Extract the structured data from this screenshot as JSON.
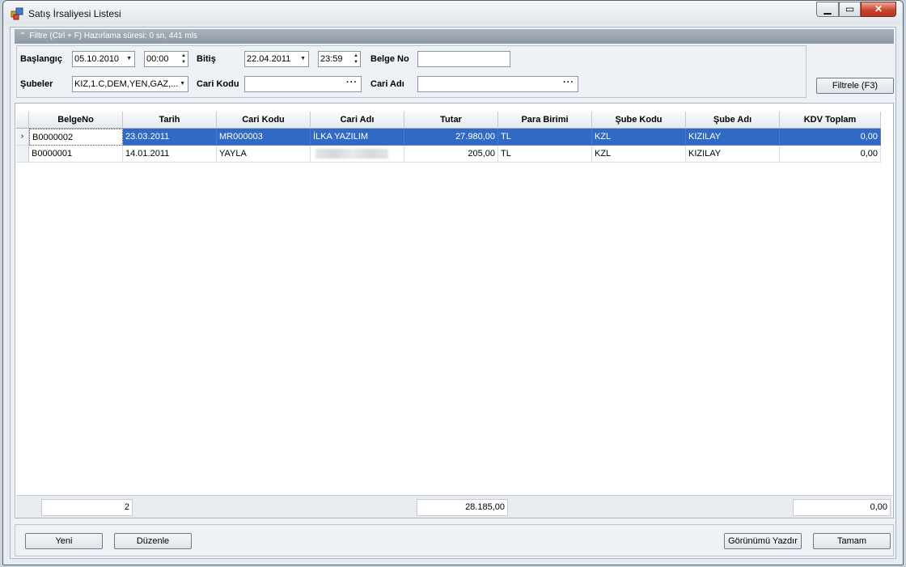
{
  "window": {
    "title": "Satış İrsaliyesi Listesi",
    "icon": "app-icon",
    "controls": [
      "minimize-icon",
      "maximize-icon",
      "close-icon"
    ]
  },
  "filter": {
    "header": "Filtre (Ctrl + F) Hazırlama süresi: 0 sn, 441 mls",
    "baslangic_label": "Başlangıç",
    "baslangic_date": "05.10.2010",
    "baslangic_time": "00:00",
    "bitis_label": "Bitiş",
    "bitis_date": "22.04.2011",
    "bitis_time": "23:59",
    "belge_no_label": "Belge No",
    "belge_no_value": "",
    "subeler_label": "Şubeler",
    "subeler_value": "KIZ,1.C,DEM,YEN,GAZ,...",
    "cari_kodu_label": "Cari Kodu",
    "cari_kodu_value": "",
    "cari_adi_label": "Cari Adı",
    "cari_adi_value": "",
    "filter_button": "Filtrele (F3)"
  },
  "grid": {
    "columns": [
      "BelgeNo",
      "Tarih",
      "Cari Kodu",
      "Cari Adı",
      "Tutar",
      "Para Birimi",
      "Şube Kodu",
      "Şube Adı",
      "KDV Toplam"
    ],
    "rows": [
      {
        "belge_no": "B0000002",
        "tarih": "23.03.2011",
        "cari_kodu": "MR000003",
        "cari_adi": "İLKA YAZILIM",
        "tutar": "27.980,00",
        "para_birimi": "TL",
        "sube_kodu": "KZL",
        "sube_adi": "KIZILAY",
        "kdv": "0,00"
      },
      {
        "belge_no": "B0000001",
        "tarih": "14.01.2011",
        "cari_kodu": "YAYLA",
        "cari_adi": "",
        "tutar": "205,00",
        "para_birimi": "TL",
        "sube_kodu": "KZL",
        "sube_adi": "KIZILAY",
        "kdv": "0,00"
      }
    ],
    "footer": {
      "count": "2",
      "tutar_total": "28.185,00",
      "kdv_total": "0,00"
    }
  },
  "actions": {
    "yeni": "Yeni",
    "duzenle": "Düzenle",
    "print": "Görünümü Yazdır",
    "ok": "Tamam"
  }
}
